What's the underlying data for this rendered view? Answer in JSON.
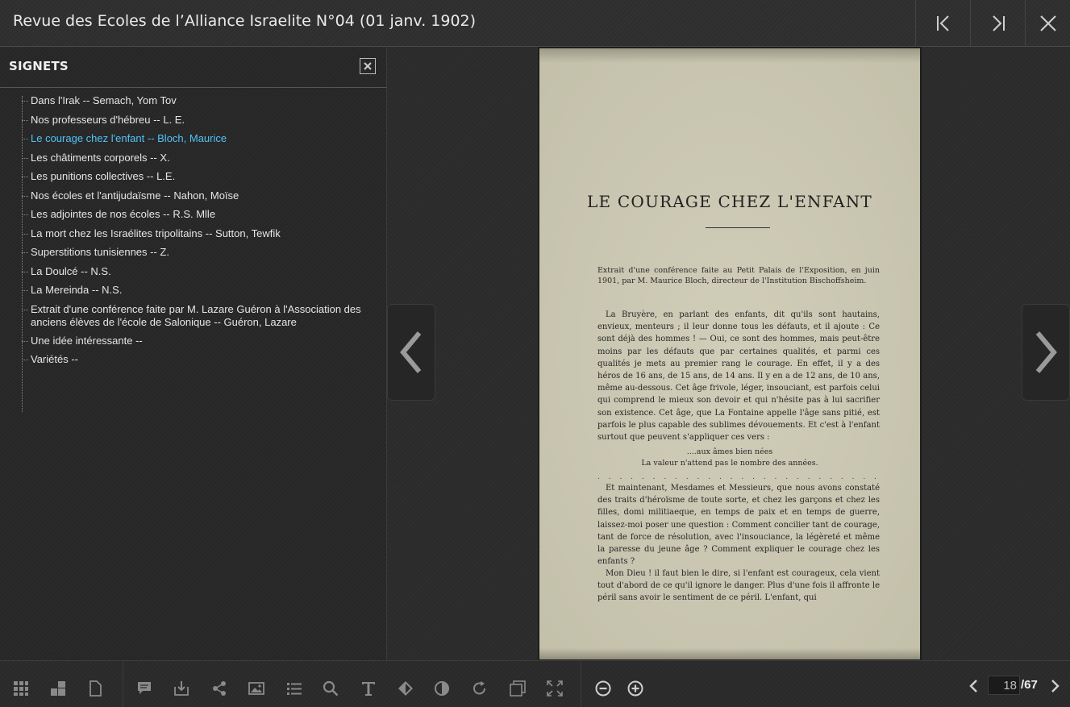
{
  "header": {
    "title": "Revue des Ecoles de l’Alliance Israelite N°04 (01 janv. 1902)",
    "buttons": [
      "first-page",
      "last-page",
      "close"
    ]
  },
  "sidebar": {
    "title": "SIGNETS",
    "items": [
      {
        "label": "Dans l'Irak -- Semach, Yom Tov"
      },
      {
        "label": "Nos professeurs d'hébreu -- L. E."
      },
      {
        "label": "Le courage chez l'enfant -- Bloch, Maurice",
        "active": true
      },
      {
        "label": "Les châtiments corporels -- X."
      },
      {
        "label": "Les punitions collectives -- L.E."
      },
      {
        "label": "Nos écoles et l'antijudaïsme -- Nahon, Moïse"
      },
      {
        "label": "Les adjointes de nos écoles -- R.S. Mlle"
      },
      {
        "label": "La mort chez les Israélites tripolitains -- Sutton, Tewfik"
      },
      {
        "label": "Superstitions tunisiennes -- Z."
      },
      {
        "label": "La Doulcé -- N.S."
      },
      {
        "label": "La Mereinda -- N.S."
      },
      {
        "label": "Extrait d'une conférence faite par M. Lazare Guéron à l'Association des anciens élèves de l'école de Salonique -- Guéron, Lazare"
      },
      {
        "label": "Une idée intéressante --"
      },
      {
        "label": "Variétés --"
      }
    ]
  },
  "page": {
    "title": "LE COURAGE CHEZ L'ENFANT",
    "intro": "Extrait d'une conférence faite au Petit Palais de l'Exposition, en juin 1901, par M. Maurice Bloch, directeur de l'Institution Bischoffsheim.",
    "para1": "La Bruyère, en parlant des enfants, dit qu'ils sont hautains, envieux, menteurs ; il leur donne tous les défauts, et il ajoute : Ce sont déjà des hommes ! — Oui, ce sont des hommes, mais peut-être moins par les défauts que par certaines qualités, et parmi ces qualités je mets au premier rang le courage. En effet, il y a des héros de 16 ans, de 15 ans, de 14 ans. Il y en a de 12 ans, de 10 ans, même au-dessous. Cet âge frivole, léger, insouciant, est parfois celui qui comprend le mieux son devoir et qui n'hésite pas à lui sacrifier son existence. Cet âge, que La Fontaine appelle l'âge sans pitié, est parfois le plus capable des sublimes dévouements. Et c'est à l'enfant surtout que peuvent s'appliquer ces vers :",
    "verse1": "....aux âmes bien nées",
    "verse2": "La valeur n'attend pas le nombre des années.",
    "dots": ". . . . . . . . . . . . . . . . . . . . . . . . . . . . . . . . . . . . . . . . . . . . . .",
    "para2": "Et maintenant, Mesdames et Messieurs, que nous avons constaté des traits d'héroïsme de toute sorte, et chez les garçons et chez les filles, domi militiaeque, en temps de paix et en temps de guerre, laissez-moi poser une question : Comment concilier tant de courage, tant de force de résolution, avec l'insouciance, la légèreté et même la paresse du jeune âge ? Comment expliquer le courage chez les enfants ?",
    "para3": "Mon Dieu ! il faut bien le dire, si l'enfant est courageux, cela vient tout d'abord de ce qu'il ignore le danger. Plus d'une fois il affronte le péril sans avoir le sentiment de ce péril. L'enfant, qui"
  },
  "toolbar": {
    "icons": [
      "grid-view-icon",
      "mosaic-view-icon",
      "single-page-icon",
      "comment-icon",
      "download-icon",
      "share-icon",
      "image-icon",
      "list-icon",
      "search-icon",
      "text-icon",
      "contrast-diamond-icon",
      "contrast-icon",
      "rotate-icon",
      "double-page-icon",
      "fullscreen-icon",
      "zoom-out-icon",
      "zoom-in-icon"
    ],
    "current_page": "18",
    "total_pages": "/67"
  },
  "colors": {
    "accent": "#4fc3f7",
    "background": "#2b2b2b",
    "page_paper": "#c9c6b2"
  }
}
